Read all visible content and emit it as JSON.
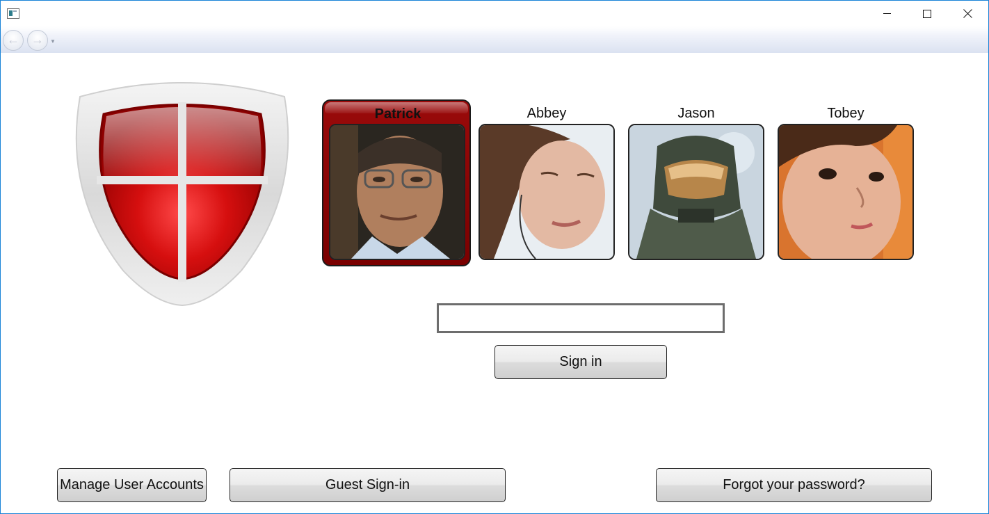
{
  "window": {
    "title": "",
    "controls": {
      "minimize": "minimize-icon",
      "maximize": "maximize-icon",
      "close": "close-icon"
    }
  },
  "navbar": {
    "back_icon": "back-arrow-icon",
    "forward_icon": "forward-arrow-icon",
    "history_icon": "history-dropdown-icon"
  },
  "logo": {
    "icon": "shield-icon",
    "colors": {
      "shield": "#b30000",
      "rim": "#dcdcdc"
    }
  },
  "users": [
    {
      "name": "Patrick",
      "selected": true
    },
    {
      "name": "Abbey",
      "selected": false
    },
    {
      "name": "Jason",
      "selected": false
    },
    {
      "name": "Tobey",
      "selected": false
    }
  ],
  "password": {
    "value": "",
    "placeholder": ""
  },
  "buttons": {
    "sign_in": "Sign in",
    "manage_accounts": "Manage User Accounts",
    "guest_sign_in": "Guest Sign-in",
    "forgot_password": "Forgot your password?"
  },
  "colors": {
    "selected_tile": "#8a0000",
    "window_border": "#1883d7"
  }
}
